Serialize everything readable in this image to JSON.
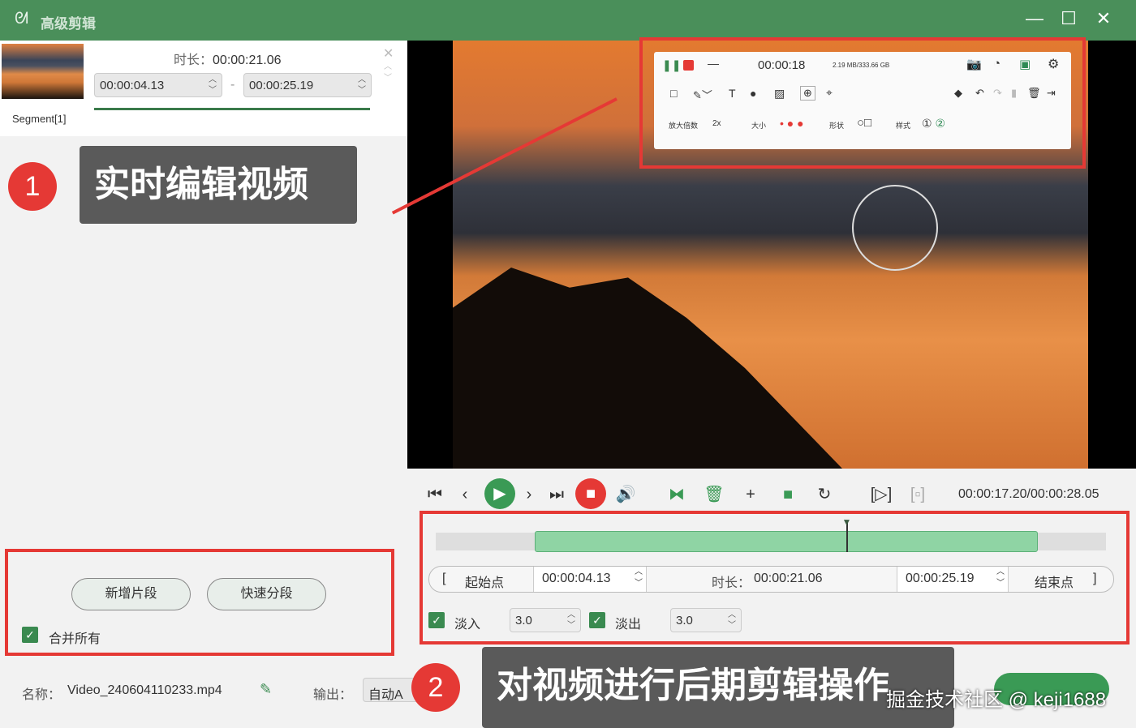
{
  "window": {
    "title": "高级剪辑",
    "logo_icon": "rabbit-logo-icon",
    "minimize": "—",
    "maximize": "☐",
    "close": "✕"
  },
  "segment": {
    "label": "Segment[1]",
    "duration_label": "时长：",
    "duration": "00:00:21.06",
    "start": "00:00:04.13",
    "end": "00:00:25.19",
    "separator": "-"
  },
  "callouts": [
    {
      "num": "1",
      "text": "实时编辑视频"
    },
    {
      "num": "2",
      "text": "对视频进行后期剪辑操作"
    }
  ],
  "recorder": {
    "time": "00:00:18",
    "storage": "2.19 MB/333.66 GB",
    "zoom_label": "放大倍数",
    "zoom_value": "2x",
    "size_label": "大小",
    "shape_label": "形状",
    "style_label": "样式"
  },
  "player": {
    "time": "00:00:17.20/00:00:28.05",
    "current_seconds": 17.2,
    "total_seconds": 28.05,
    "start_seconds": 4.13,
    "end_seconds": 25.19
  },
  "trim": {
    "start_btn": "起始点",
    "start": "00:00:04.13",
    "duration_label": "时长：",
    "duration": "00:00:21.06",
    "end": "00:00:25.19",
    "end_btn": "结束点",
    "bracket_open": "[",
    "bracket_close": "]"
  },
  "fade": {
    "in_label": "淡入",
    "in_value": "3.0",
    "out_label": "淡出",
    "out_value": "3.0",
    "in_checked": true,
    "out_checked": true
  },
  "left_actions": {
    "add_segment": "新增片段",
    "quick_split": "快速分段",
    "merge_all": "合并所有",
    "merge_checked": true
  },
  "footer": {
    "name_label": "名称：",
    "name": "Video_240604110233.mp4",
    "output_label": "输出：",
    "output_value": "自动A",
    "watermark": "掘金技术社区 @ keji1688"
  },
  "colors": {
    "accent": "#4a8f5a",
    "highlight": "#e53935",
    "timeline_selection": "#8fd4a4"
  }
}
